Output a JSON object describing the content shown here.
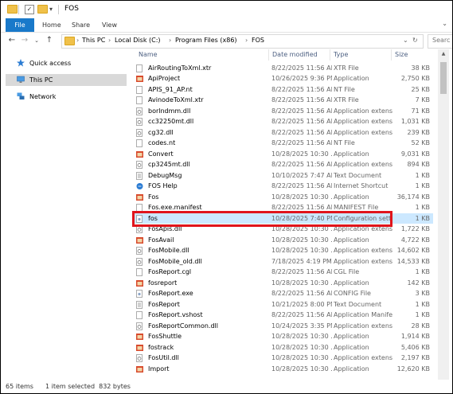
{
  "window": {
    "title": "FOS"
  },
  "ribbon": {
    "tabs": [
      "File",
      "Home",
      "Share",
      "View"
    ]
  },
  "address": {
    "crumbs": [
      "This PC",
      "Local Disk (C:)",
      "Program Files (x86)",
      "FOS"
    ],
    "search_placeholder": "Searc"
  },
  "nav": {
    "items": [
      {
        "label": "Quick access",
        "icon": "star-icon"
      },
      {
        "label": "This PC",
        "icon": "computer-icon"
      },
      {
        "label": "Network",
        "icon": "network-icon"
      }
    ]
  },
  "columns": {
    "name": "Name",
    "date": "Date modified",
    "type": "Type",
    "size": "Size"
  },
  "files": [
    {
      "name": "AirRoutingToXml.xtr",
      "date": "8/22/2025 11:56 AM",
      "type": "XTR File",
      "size": "38 KB",
      "icon": "file-icon"
    },
    {
      "name": "ApiProject",
      "date": "10/26/2025 9:36 PM",
      "type": "Application",
      "size": "2,750 KB",
      "icon": "app-icon"
    },
    {
      "name": "APIS_91_AP.nt",
      "date": "8/22/2025 11:56 AM",
      "type": "NT File",
      "size": "25 KB",
      "icon": "file-icon"
    },
    {
      "name": "AvinodeToXml.xtr",
      "date": "8/22/2025 11:56 AM",
      "type": "XTR File",
      "size": "7 KB",
      "icon": "file-icon"
    },
    {
      "name": "borlndmm.dll",
      "date": "8/22/2025 11:56 AM",
      "type": "Application extens...",
      "size": "71 KB",
      "icon": "dll-icon"
    },
    {
      "name": "cc32250mt.dll",
      "date": "8/22/2025 11:56 AM",
      "type": "Application extens...",
      "size": "1,031 KB",
      "icon": "dll-icon"
    },
    {
      "name": "cg32.dll",
      "date": "8/22/2025 11:56 AM",
      "type": "Application extens...",
      "size": "239 KB",
      "icon": "dll-icon"
    },
    {
      "name": "codes.nt",
      "date": "8/22/2025 11:56 AM",
      "type": "NT File",
      "size": "52 KB",
      "icon": "file-icon"
    },
    {
      "name": "Convert",
      "date": "10/28/2025 10:30 ...",
      "type": "Application",
      "size": "9,031 KB",
      "icon": "app-icon"
    },
    {
      "name": "cp3245mt.dll",
      "date": "8/22/2025 11:56 AM",
      "type": "Application extens...",
      "size": "894 KB",
      "icon": "dll-icon"
    },
    {
      "name": "DebugMsg",
      "date": "10/10/2025 7:47 AM",
      "type": "Text Document",
      "size": "1 KB",
      "icon": "text-icon"
    },
    {
      "name": "FOS Help",
      "date": "8/22/2025 11:56 AM",
      "type": "Internet Shortcut",
      "size": "1 KB",
      "icon": "shortcut-icon"
    },
    {
      "name": "Fos",
      "date": "10/28/2025 10:30 ...",
      "type": "Application",
      "size": "36,174 KB",
      "icon": "app-icon"
    },
    {
      "name": "Fos.exe.manifest",
      "date": "8/22/2025 11:56 AM",
      "type": "MANIFEST File",
      "size": "1 KB",
      "icon": "file-icon"
    },
    {
      "name": "fos",
      "date": "10/28/2025 7:40 PM",
      "type": "Configuration sett...",
      "size": "1 KB",
      "icon": "config-icon"
    },
    {
      "name": "FosApis.dll",
      "date": "10/28/2025 10:30 ...",
      "type": "Application extens...",
      "size": "1,722 KB",
      "icon": "dll-icon"
    },
    {
      "name": "FosAvail",
      "date": "10/28/2025 10:30 ...",
      "type": "Application",
      "size": "4,722 KB",
      "icon": "app-icon"
    },
    {
      "name": "FosMobile.dll",
      "date": "10/28/2025 10:30 ...",
      "type": "Application extens...",
      "size": "14,602 KB",
      "icon": "dll-icon"
    },
    {
      "name": "FosMobile_old.dll",
      "date": "7/18/2025 4:19 PM",
      "type": "Application extens...",
      "size": "14,533 KB",
      "icon": "dll-icon"
    },
    {
      "name": "FosReport.cgl",
      "date": "8/22/2025 11:56 AM",
      "type": "CGL File",
      "size": "1 KB",
      "icon": "file-icon"
    },
    {
      "name": "fosreport",
      "date": "10/28/2025 10:30 ...",
      "type": "Application",
      "size": "142 KB",
      "icon": "app-icon"
    },
    {
      "name": "FosReport.exe",
      "date": "8/22/2025 11:56 AM",
      "type": "CONFIG File",
      "size": "3 KB",
      "icon": "config-icon"
    },
    {
      "name": "FosReport",
      "date": "10/21/2025 8:00 PM",
      "type": "Text Document",
      "size": "1 KB",
      "icon": "text-icon"
    },
    {
      "name": "FosReport.vshost",
      "date": "8/22/2025 11:56 AM",
      "type": "Application Manife...",
      "size": "1 KB",
      "icon": "file-icon"
    },
    {
      "name": "FosReportCommon.dll",
      "date": "10/24/2025 3:35 PM",
      "type": "Application extens...",
      "size": "28 KB",
      "icon": "dll-icon"
    },
    {
      "name": "FosShuttle",
      "date": "10/28/2025 10:30 ...",
      "type": "Application",
      "size": "1,914 KB",
      "icon": "app-icon"
    },
    {
      "name": "fostrack",
      "date": "10/28/2025 10:30 ...",
      "type": "Application",
      "size": "5,406 KB",
      "icon": "app-icon"
    },
    {
      "name": "FosUtil.dll",
      "date": "10/28/2025 10:30 ...",
      "type": "Application extens...",
      "size": "2,197 KB",
      "icon": "dll-icon"
    },
    {
      "name": "Import",
      "date": "10/28/2025 10:30 ...",
      "type": "Application",
      "size": "12,620 KB",
      "icon": "app-icon"
    }
  ],
  "selected_index": 14,
  "status": {
    "count": "65 items",
    "selection": "1 item selected  832 bytes"
  },
  "colors": {
    "file_tab": "#1979ca",
    "selection": "#cce8ff",
    "highlight_border": "#e0151c"
  }
}
